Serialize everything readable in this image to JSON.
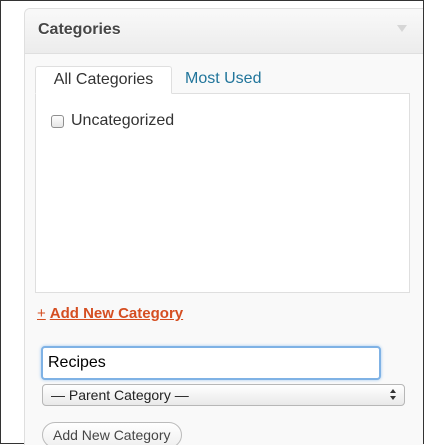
{
  "panel": {
    "title": "Categories",
    "toggle_icon": "collapse-arrow-icon"
  },
  "tabs": [
    {
      "label": "All Categories",
      "active": true
    },
    {
      "label": "Most Used",
      "active": false
    }
  ],
  "categories": [
    {
      "label": "Uncategorized",
      "checked": false
    }
  ],
  "add_new": {
    "link_prefix": "+",
    "link_label": "Add New Category",
    "name_value": "Recipes",
    "parent_select_value": "— Parent Category —",
    "submit_label": "Add New Category"
  },
  "colors": {
    "link": "#21759b",
    "add_link": "#d54e21",
    "focus_border": "#7fb2e5"
  }
}
